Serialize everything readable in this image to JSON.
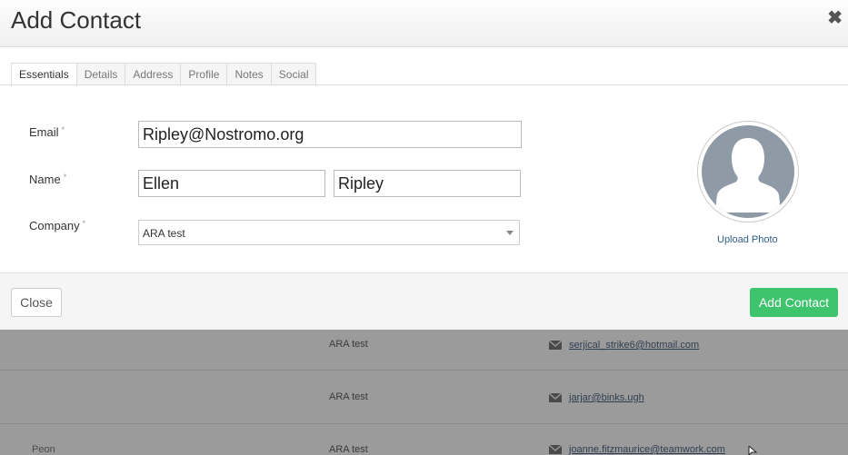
{
  "modal": {
    "title": "Add Contact",
    "close_glyph": "✖",
    "tabs": [
      {
        "label": "Essentials",
        "active": true
      },
      {
        "label": "Details",
        "active": false
      },
      {
        "label": "Address",
        "active": false
      },
      {
        "label": "Profile",
        "active": false
      },
      {
        "label": "Notes",
        "active": false
      },
      {
        "label": "Social",
        "active": false
      }
    ],
    "form": {
      "email_label": "Email",
      "email_value": "Ripley@Nostromo.org",
      "name_label": "Name",
      "first_name_value": "Ellen",
      "last_name_value": "Ripley",
      "company_label": "Company",
      "company_value": "ARA test",
      "required_mark": "*"
    },
    "avatar": {
      "icon": "person-silhouette-icon",
      "upload_label": "Upload Photo"
    },
    "footer": {
      "close_label": "Close",
      "add_label": "Add Contact"
    }
  },
  "background_rows": [
    {
      "role": "",
      "company": "ARA test",
      "email": "serjical_strike6@hotmail.com"
    },
    {
      "role": "",
      "company": "ARA test",
      "email": "jarjar@binks.ugh"
    },
    {
      "role": "Peon",
      "company": "ARA test",
      "email": "joanne.fitzmaurice@teamwork.com"
    }
  ],
  "colors": {
    "accent_green": "#3ec46d",
    "link_blue": "#2e5d8c",
    "avatar_gray": "#8e9aa6",
    "overlay_gray": "#9b9b9b"
  }
}
